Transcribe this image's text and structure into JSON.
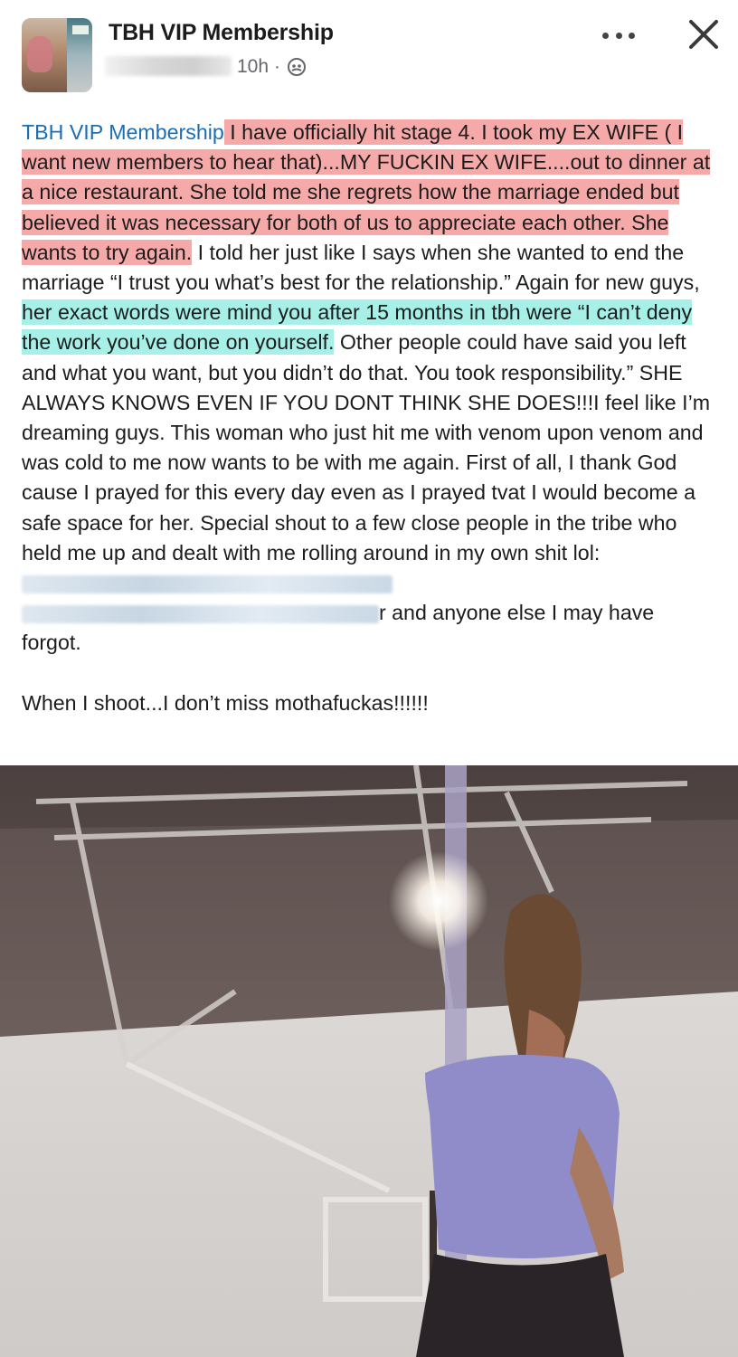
{
  "header": {
    "group_name": "TBH VIP Membership",
    "timestamp": "10h",
    "separator": "·",
    "privacy_icon": "globe-icon",
    "more_icon": "more-icon",
    "close_icon": "close-icon"
  },
  "post": {
    "group_link": "TBH VIP Membership",
    "segment_1_highlighted_red": " I have officially hit stage 4. I took my EX WIFE ( I want new members to hear that)...MY FUCKIN EX WIFE....out to dinner at a nice restaurant. She told me she regrets how the marriage ended but believed it was necessary for both of us to appreciate each other. She wants to try again.",
    "segment_2": " I told her just like I says when she wanted to end the marriage “I trust you what’s best for the relationship.” Again for new guys,",
    "segment_3_highlighted_cyan": " her exact words were mind you after 15 months in tbh were “I can’t deny the work you’ve done on yourself.",
    "segment_4": " Other people could have said you left and what you want, but you didn’t do that. You took responsibility.”  SHE ALWAYS KNOWS EVEN IF YOU DONT THINK SHE DOES!!!I feel like I’m dreaming guys. This woman who just hit me with venom upon venom and was cold to me now wants to be with me again.  First of all, I thank God cause I prayed for this every day even as I prayed tvat I would become a safe space for her. Special shout to a few close people in the tribe who held me up and dealt with me rolling around in my own shit lol: ",
    "segment_5": "r and anyone else I may have forgot.",
    "closing_line": "When I shoot...I don’t miss mothafuckas!!!!!!"
  },
  "colors": {
    "group_link": "#1b6db4",
    "highlight_red": "#f6a9a9",
    "highlight_cyan": "#a6f0e8",
    "meta_text": "#65676b",
    "body_text": "#1c1c1c"
  }
}
